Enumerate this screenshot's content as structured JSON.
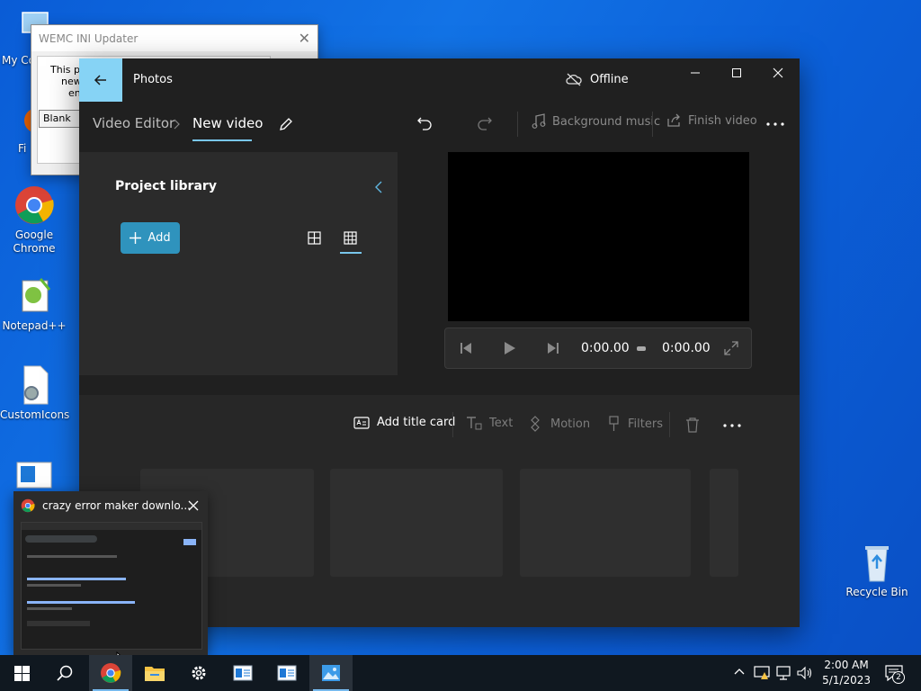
{
  "desktop": {
    "icons": [
      {
        "label": "My Co"
      },
      {
        "label": "Fi"
      },
      {
        "label": "Google Chrome"
      },
      {
        "label": "Notepad++"
      },
      {
        "label": "CustomIcons"
      },
      {
        "label": "Recycle Bin"
      }
    ]
  },
  "wemc_window": {
    "title": "WEMC INI Updater",
    "text_line1": "This pro",
    "text_line2": "new v",
    "text_line3": "entir",
    "select_value": "Blank"
  },
  "photos": {
    "app_title": "Photos",
    "status": "Offline",
    "breadcrumb_root": "Video Editor",
    "breadcrumb_current": "New video",
    "background_music": "Background music",
    "finish_video": "Finish video",
    "library_title": "Project library",
    "add_label": "Add",
    "time_current": "0:00.00",
    "time_total": "0:00.00",
    "add_title_card": "Add title card",
    "text_tool": "Text",
    "motion_tool": "Motion",
    "filters_tool": "Filters"
  },
  "chrome_thumbnail": {
    "title": "crazy error maker downlo..."
  },
  "taskbar": {
    "time": "2:00 AM",
    "date": "5/1/2023",
    "notification_count": "2"
  }
}
